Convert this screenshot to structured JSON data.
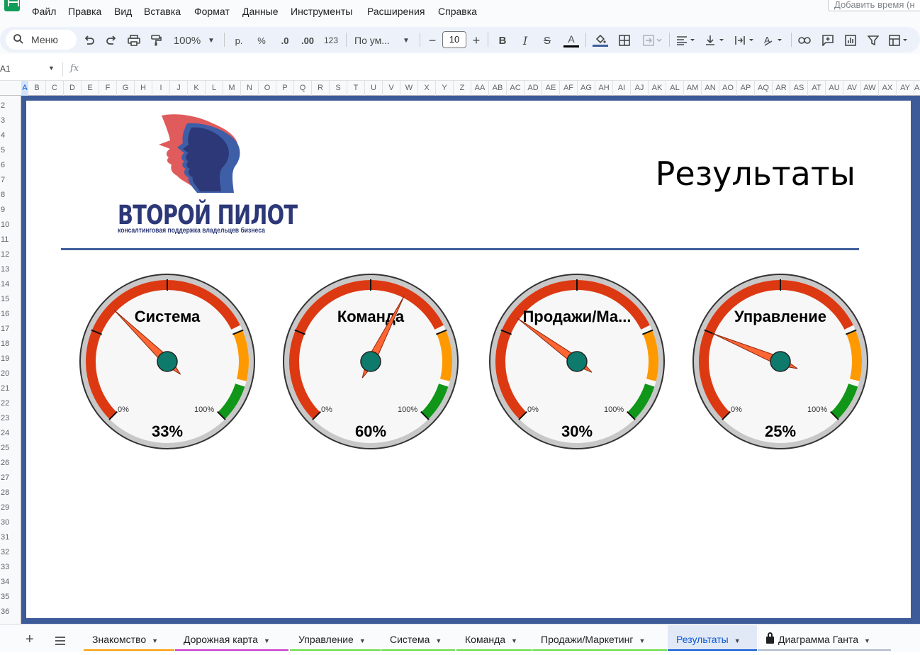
{
  "menu": [
    "Файл",
    "Правка",
    "Вид",
    "Вставка",
    "Формат",
    "Данные",
    "Инструменты",
    "Расширения",
    "Справка"
  ],
  "time_box": "Добавить время (н",
  "toolbar": {
    "search_label": "Меню",
    "zoom": "100%",
    "currency": "р.",
    "percent": "%",
    "dec_less": ".0",
    "dec_more": ".00",
    "format_num": "123",
    "font_name": "По ум...",
    "font_size": "10"
  },
  "formula": {
    "cell_ref": "A1",
    "fx": "fx"
  },
  "columns": [
    "A",
    "B",
    "C",
    "D",
    "E",
    "F",
    "G",
    "H",
    "I",
    "J",
    "K",
    "L",
    "M",
    "N",
    "O",
    "P",
    "Q",
    "R",
    "S",
    "T",
    "U",
    "V",
    "W",
    "X",
    "Y",
    "Z",
    "AA",
    "AB",
    "AC",
    "AD",
    "AE",
    "AF",
    "AG",
    "AH",
    "AI",
    "AJ",
    "AK",
    "AL",
    "AM",
    "AN",
    "AO",
    "AP",
    "AQ",
    "AR",
    "AS",
    "AT",
    "AU",
    "AV",
    "AW",
    "AX",
    "AY",
    "AZ"
  ],
  "rows": [
    "2",
    "3",
    "4",
    "5",
    "6",
    "7",
    "8",
    "9",
    "10",
    "11",
    "12",
    "13",
    "14",
    "15",
    "16",
    "17",
    "18",
    "19",
    "20",
    "21",
    "22",
    "23",
    "24",
    "25",
    "26",
    "27",
    "28",
    "29",
    "30",
    "31",
    "32",
    "33",
    "34",
    "35",
    "36"
  ],
  "sheet": {
    "title": "Результаты",
    "logo": {
      "name": "ВТОРОЙ ПИЛОТ",
      "tagline": "консалтинговая поддержка владельцев бизнеса"
    }
  },
  "gauges": [
    {
      "label": "Система",
      "value_text": "33%",
      "value": 33,
      "min_label": "0%",
      "max_label": "100%"
    },
    {
      "label": "Команда",
      "value_text": "60%",
      "value": 60,
      "min_label": "0%",
      "max_label": "100%"
    },
    {
      "label": "Продажи/Ма...",
      "value_text": "30%",
      "value": 30,
      "min_label": "0%",
      "max_label": "100%"
    },
    {
      "label": "Управление",
      "value_text": "25%",
      "value": 25,
      "min_label": "0%",
      "max_label": "100%"
    }
  ],
  "gauge_colors": {
    "red": "#dc3912",
    "orange": "#ff9900",
    "green": "#109618",
    "needle": "#ff6633",
    "hub": "#0d7a6b"
  },
  "tabs": [
    {
      "label": "Знакомство",
      "color": "#ff9900",
      "active": false
    },
    {
      "label": "Дорожная карта",
      "color": "#cc33cc",
      "active": false
    },
    {
      "label": "Управление",
      "color": "#66dd44",
      "active": false
    },
    {
      "label": "Система",
      "color": "#66dd44",
      "active": false
    },
    {
      "label": "Команда",
      "color": "#66dd44",
      "active": false
    },
    {
      "label": "Продажи/Маркетинг",
      "color": "#66dd44",
      "active": false
    },
    {
      "label": "Результаты",
      "color": "#0b57d0",
      "active": true
    },
    {
      "label": "Диаграмма Ганта",
      "color": "#b0b8c8",
      "active": false,
      "locked": true
    }
  ]
}
